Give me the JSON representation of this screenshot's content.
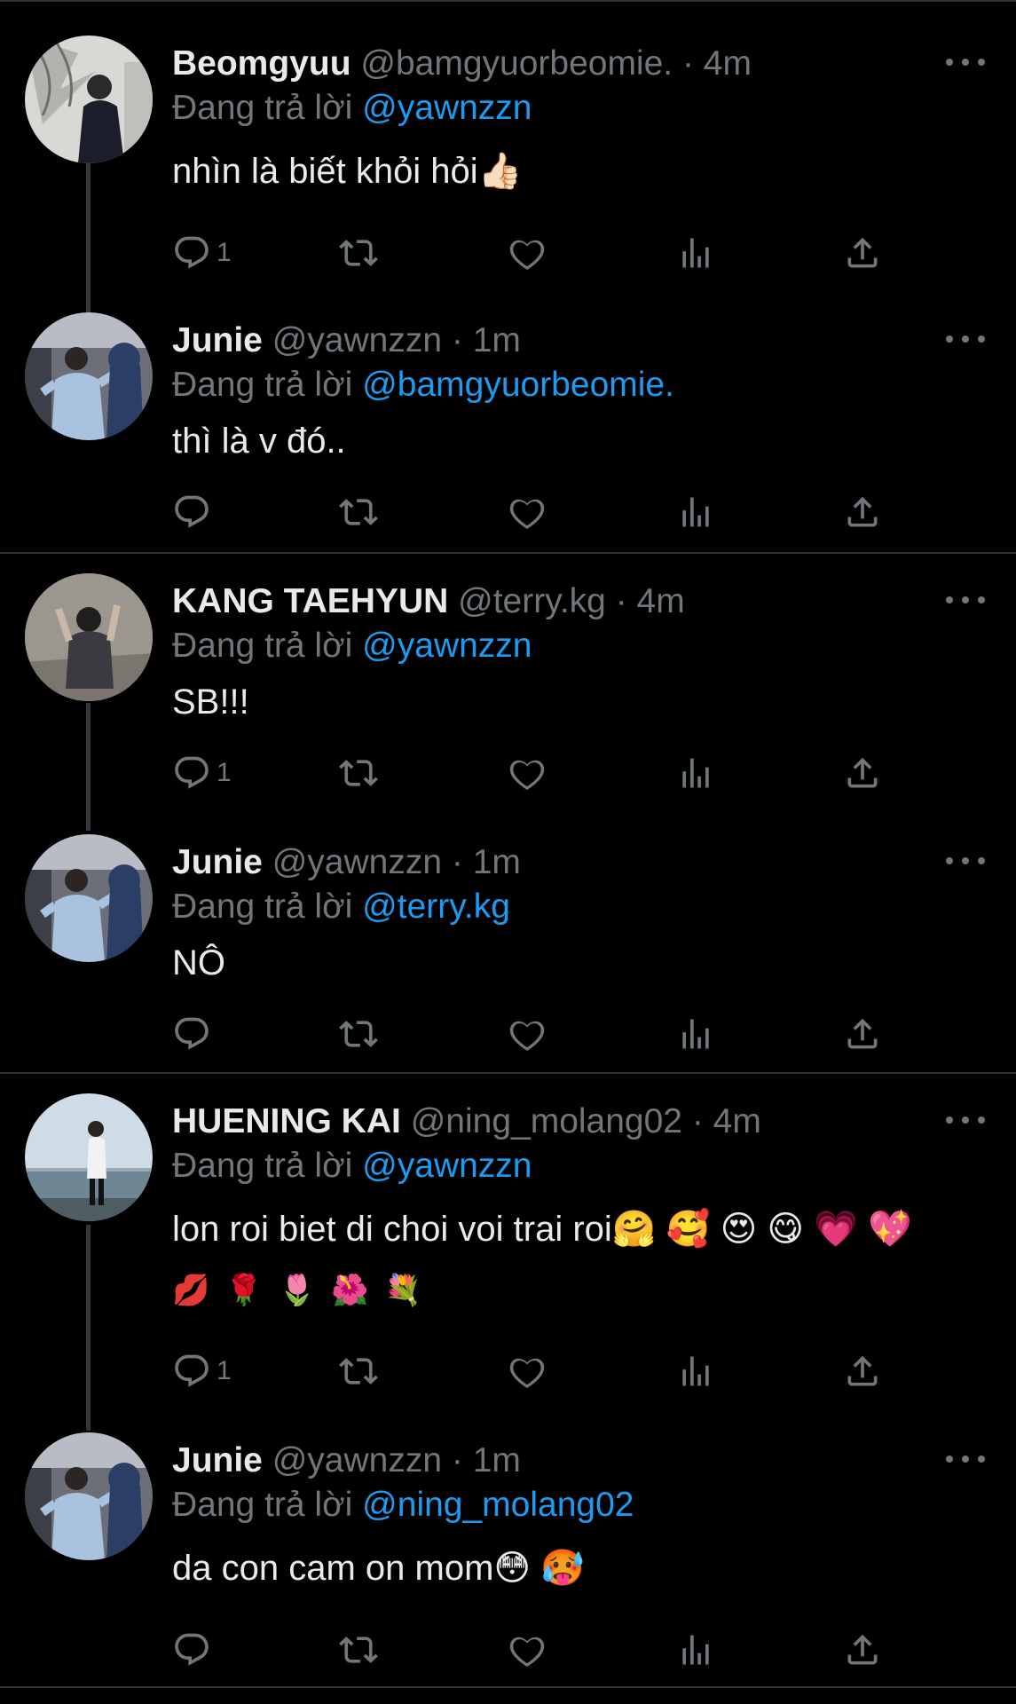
{
  "reply_prefix": "Đang trả lời",
  "colors": {
    "background": "#000000",
    "accent": "#1d9bf0",
    "muted": "#71767b",
    "divider": "#2f3336"
  },
  "icons": [
    "reply-icon",
    "retweet-icon",
    "like-icon",
    "views-icon",
    "share-icon",
    "more-icon"
  ],
  "tweets": [
    {
      "name": "Beomgyuu",
      "handle": "@bamgyuorbeomie.",
      "time": "· 4m",
      "reply_to": "@yawnzzn",
      "text": "nhìn là biết khỏi hỏi👍🏻",
      "reply_count": "1"
    },
    {
      "name": "Junie",
      "handle": "@yawnzzn",
      "time": "· 1m",
      "reply_to": "@bamgyuorbeomie.",
      "text": "thì là v đó..",
      "reply_count": ""
    },
    {
      "name": "KANG TAEHYUN",
      "handle": "@terry.kg",
      "time": "· 4m",
      "reply_to": "@yawnzzn",
      "text": "SB!!!",
      "reply_count": "1"
    },
    {
      "name": "Junie",
      "handle": "@yawnzzn",
      "time": "· 1m",
      "reply_to": "@terry.kg",
      "text": "NÔ",
      "reply_count": ""
    },
    {
      "name": "HUENING KAI",
      "handle": "@ning_molang02",
      "time": "· 4m",
      "reply_to": "@yawnzzn",
      "text": "lon roi biet di choi voi trai roi🤗 🥰 😍 😋 💗 💖",
      "text2": "💋 🌹 🌷 🌺 💐",
      "reply_count": "1"
    },
    {
      "name": "Junie",
      "handle": "@yawnzzn",
      "time": "· 1m",
      "reply_to": "@ning_molang02",
      "text": "da con cam on mom😳 🥵",
      "reply_count": ""
    }
  ]
}
